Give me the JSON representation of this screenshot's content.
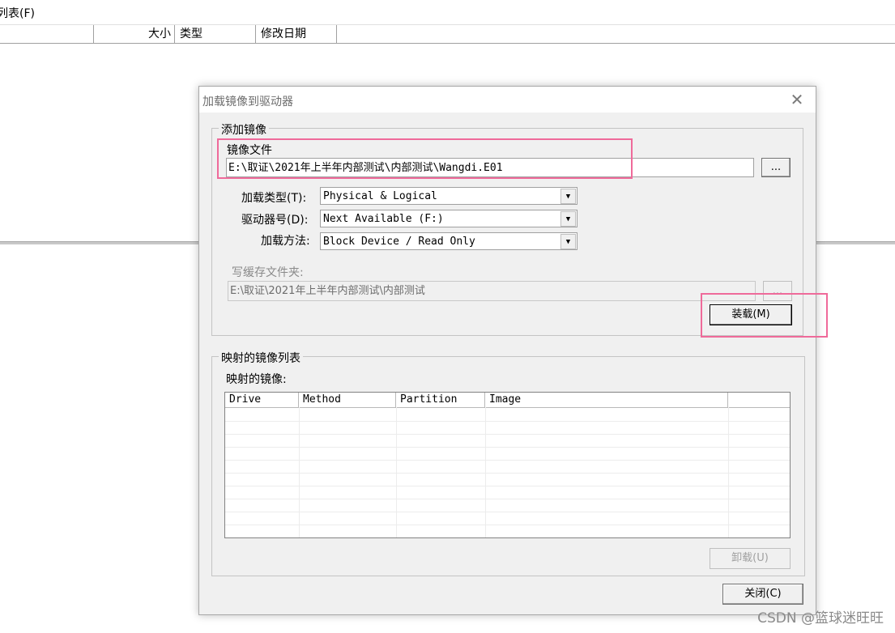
{
  "background": {
    "menu_text": "列表(F)",
    "columns": [
      "",
      "大小",
      "类型",
      "修改日期"
    ]
  },
  "dialog": {
    "title": "加载镜像到驱动器",
    "close_icon": "close-icon",
    "add_group": {
      "title": "添加镜像",
      "image_file_label": "镜像文件",
      "image_file_value": "E:\\取证\\2021年上半年内部测试\\内部测试\\Wangdi.E01",
      "browse_label": "...",
      "mount_type_label": "加载类型(T):",
      "mount_type_value": "Physical & Logical",
      "drive_letter_label": "驱动器号(D):",
      "drive_letter_value": "Next Available (F:)",
      "mount_method_label": "加载方法:",
      "mount_method_value": "Block Device / Read Only",
      "write_cache_label": "写缓存文件夹:",
      "write_cache_value": "E:\\取证\\2021年上半年内部测试\\内部测试",
      "write_cache_browse": "...",
      "mount_button": "装载(M)"
    },
    "mapped_group": {
      "title": "映射的镜像列表",
      "list_label": "映射的镜像:",
      "columns": [
        "Drive",
        "Method",
        "Partition",
        "Image",
        ""
      ],
      "unmount_button": "卸载(U)"
    },
    "close_button": "关闭(C)"
  },
  "accent_colors": {
    "highlight_box": "#ef6a9a"
  },
  "watermark": "CSDN @篮球迷旺旺"
}
